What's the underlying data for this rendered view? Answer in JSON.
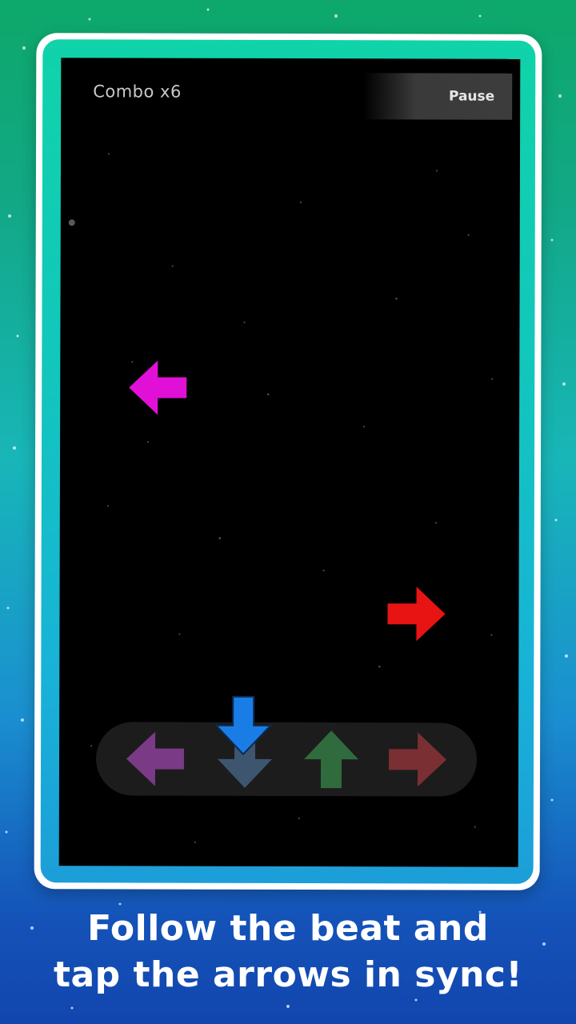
{
  "hud": {
    "combo_text": "Combo x6",
    "pause_label": "Pause"
  },
  "caption": {
    "line1": "Follow the beat and",
    "line2": "tap the arrows in sync!"
  },
  "receptors": [
    {
      "direction": "left",
      "color": "#7a3a86"
    },
    {
      "direction": "down",
      "color": "#3e5570"
    },
    {
      "direction": "up",
      "color": "#2f6b3d"
    },
    {
      "direction": "right",
      "color": "#7a2f33"
    }
  ],
  "falling_notes": [
    {
      "direction": "left",
      "color": "#e010d6"
    },
    {
      "direction": "right",
      "color": "#e81414"
    },
    {
      "direction": "down",
      "color": "#1a7de6"
    }
  ],
  "colors": {
    "background_top": "#0da86a",
    "background_bottom": "#1246ae",
    "frame_accent": "#10d3a9",
    "game_bg": "#000000"
  }
}
